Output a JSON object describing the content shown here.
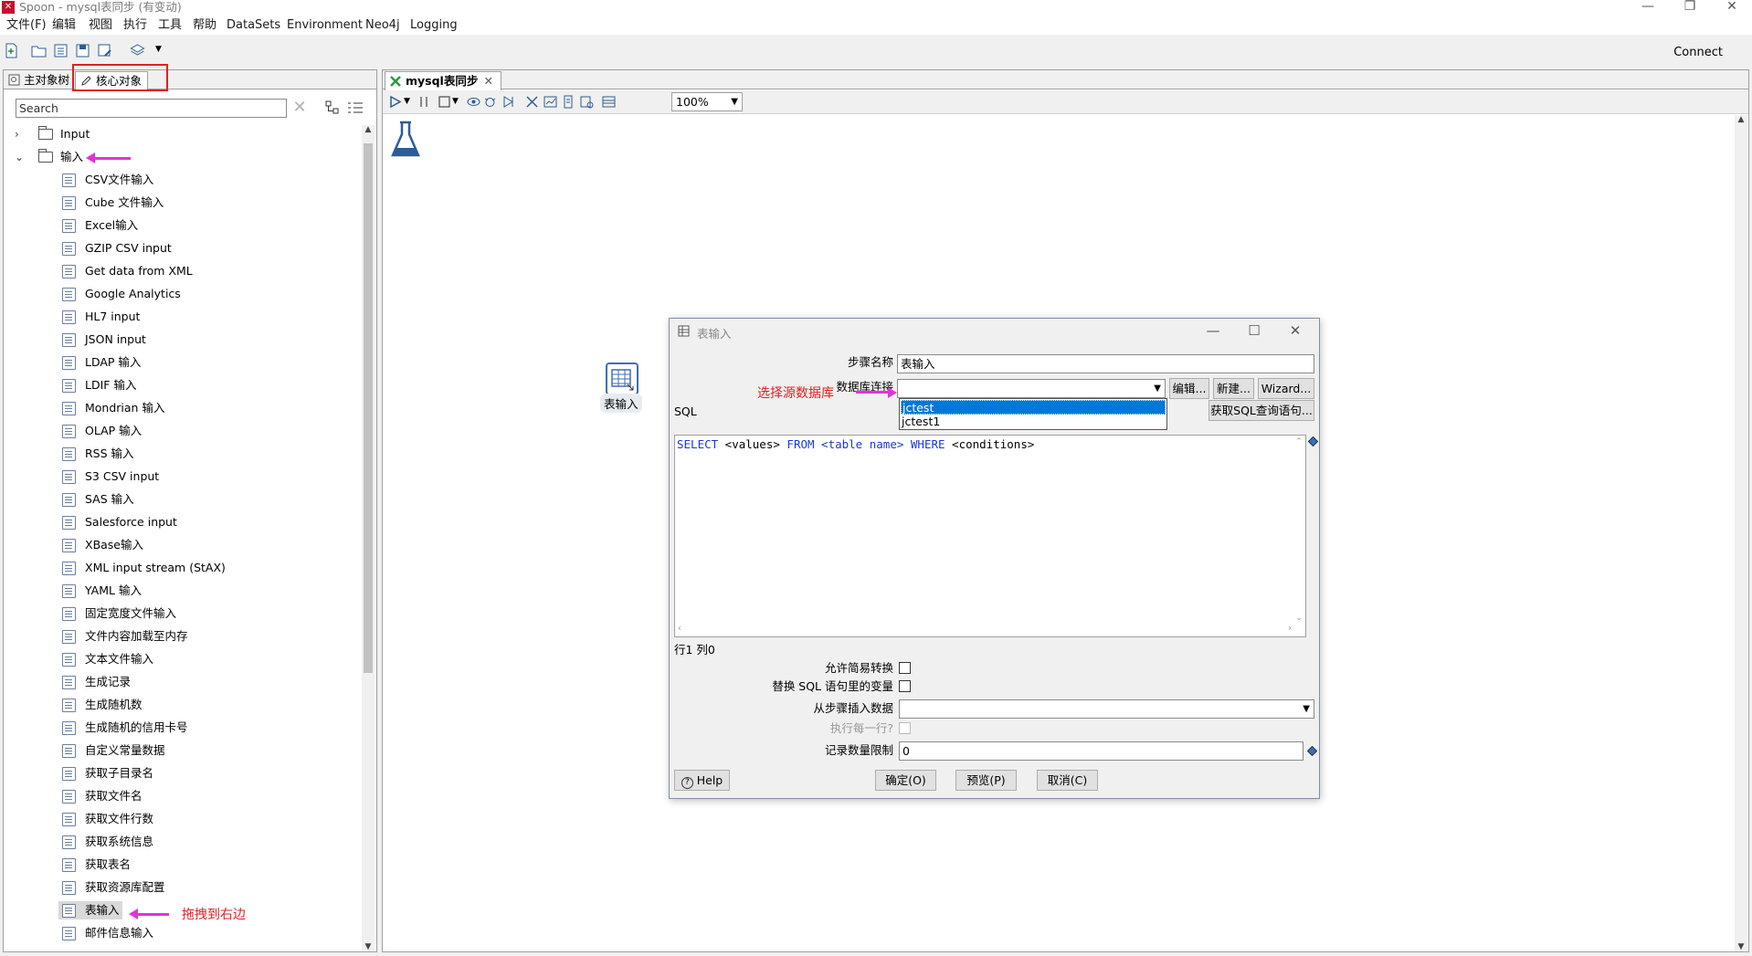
{
  "window": {
    "title": "Spoon - mysql表同步 (有变动)"
  },
  "menu": [
    "文件(F)",
    "编辑",
    "视图",
    "执行",
    "工具",
    "帮助",
    "DataSets",
    "Environment",
    "Neo4j",
    "Logging"
  ],
  "toolbar": {
    "connect_label": "Connect"
  },
  "left_panel": {
    "tabs": [
      "主对象树",
      "核心对象"
    ],
    "search_placeholder": "Search",
    "tree": [
      {
        "label": "Input",
        "type": "folder",
        "expanded": false
      },
      {
        "label": "输入",
        "type": "folder",
        "expanded": true
      },
      {
        "label": "CSV文件输入"
      },
      {
        "label": "Cube 文件输入"
      },
      {
        "label": "Excel输入"
      },
      {
        "label": "GZIP CSV input"
      },
      {
        "label": "Get data from XML"
      },
      {
        "label": "Google Analytics"
      },
      {
        "label": "HL7 input"
      },
      {
        "label": "JSON input"
      },
      {
        "label": "LDAP 输入"
      },
      {
        "label": "LDIF 输入"
      },
      {
        "label": "Mondrian 输入"
      },
      {
        "label": "OLAP 输入"
      },
      {
        "label": "RSS 输入"
      },
      {
        "label": "S3 CSV input"
      },
      {
        "label": "SAS 输入"
      },
      {
        "label": "Salesforce input"
      },
      {
        "label": "XBase输入"
      },
      {
        "label": "XML input stream (StAX)"
      },
      {
        "label": "YAML 输入"
      },
      {
        "label": "固定宽度文件输入"
      },
      {
        "label": "文件内容加载至内存"
      },
      {
        "label": "文本文件输入"
      },
      {
        "label": "生成记录"
      },
      {
        "label": "生成随机数"
      },
      {
        "label": "生成随机的信用卡号"
      },
      {
        "label": "自定义常量数据"
      },
      {
        "label": "获取子目录名"
      },
      {
        "label": "获取文件名"
      },
      {
        "label": "获取文件行数"
      },
      {
        "label": "获取系统信息"
      },
      {
        "label": "获取表名"
      },
      {
        "label": "获取资源库配置"
      },
      {
        "label": "表输入",
        "selected": true
      },
      {
        "label": "邮件信息输入"
      }
    ]
  },
  "annotations": {
    "drag_right": "拖拽到右边",
    "select_source_db": "选择源数据库"
  },
  "editor": {
    "tab_label": "mysql表同步",
    "zoom": "100%",
    "step_label": "表输入"
  },
  "dialog": {
    "title": "表输入",
    "step_name_label": "步骤名称",
    "step_name_value": "表输入",
    "db_conn_label": "数据库连接",
    "db_options": [
      "jctest",
      "jctest1"
    ],
    "edit_btn": "编辑...",
    "new_btn": "新建...",
    "wizard_btn": "Wizard...",
    "sql_label": "SQL",
    "get_sql_btn": "获取SQL查询语句...",
    "sql_parts": [
      "SELECT",
      " <values> ",
      "FROM",
      " <table name> ",
      "WHERE",
      " <conditions>"
    ],
    "cursor_pos": "行1 列0",
    "lazy_conv_label": "允许简易转换",
    "replace_vars_label": "替换 SQL 语句里的变量",
    "insert_from_step_label": "从步骤插入数据",
    "exec_each_row_label": "执行每一行?",
    "limit_label": "记录数量限制",
    "limit_value": "0",
    "help_btn": "Help",
    "ok_btn": "确定(O)",
    "preview_btn": "预览(P)",
    "cancel_btn": "取消(C)"
  }
}
